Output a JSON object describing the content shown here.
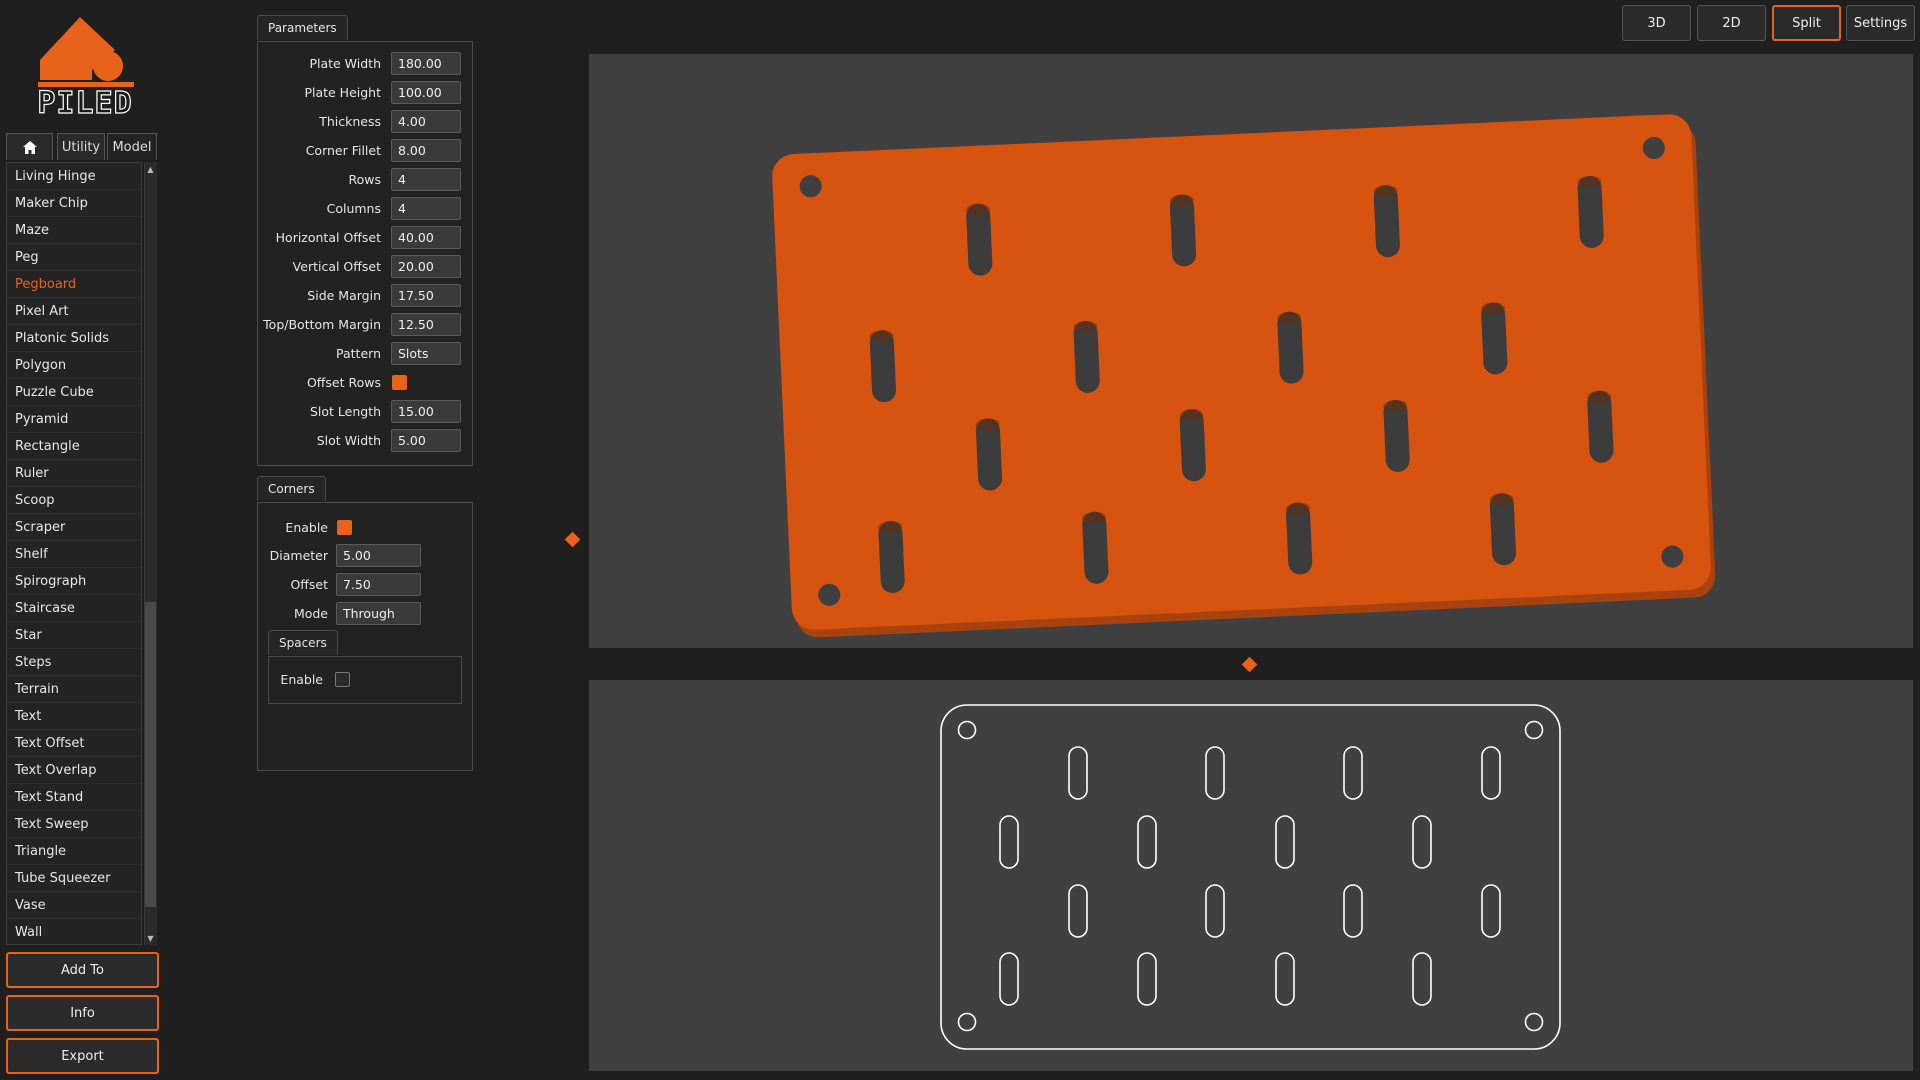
{
  "app": {
    "logo_text": "PILED",
    "accent_color": "#e8621a"
  },
  "sidebar": {
    "tabs": [
      {
        "icon": "home-icon",
        "label": ""
      },
      {
        "label": "Utility"
      },
      {
        "label": "Model"
      }
    ],
    "items": [
      "Living Hinge",
      "Maker Chip",
      "Maze",
      "Peg",
      "Pegboard",
      "Pixel Art",
      "Platonic Solids",
      "Polygon",
      "Puzzle Cube",
      "Pyramid",
      "Rectangle",
      "Ruler",
      "Scoop",
      "Scraper",
      "Shelf",
      "Spirograph",
      "Staircase",
      "Star",
      "Steps",
      "Terrain",
      "Text",
      "Text Offset",
      "Text Overlap",
      "Text Stand",
      "Text Sweep",
      "Triangle",
      "Tube Squeezer",
      "Vase",
      "Wall"
    ],
    "selected": "Pegboard",
    "buttons": {
      "add_to": "Add To",
      "info": "Info",
      "export": "Export"
    }
  },
  "parameters": {
    "title": "Parameters",
    "fields": [
      {
        "label": "Plate Width",
        "value": "180.00"
      },
      {
        "label": "Plate Height",
        "value": "100.00"
      },
      {
        "label": "Thickness",
        "value": "4.00"
      },
      {
        "label": "Corner Fillet",
        "value": "8.00"
      },
      {
        "label": "Rows",
        "value": "4"
      },
      {
        "label": "Columns",
        "value": "4"
      },
      {
        "label": "Horizontal Offset",
        "value": "40.00"
      },
      {
        "label": "Vertical Offset",
        "value": "20.00"
      },
      {
        "label": "Side Margin",
        "value": "17.50"
      },
      {
        "label": "Top/Bottom Margin",
        "value": "12.50"
      },
      {
        "label": "Pattern",
        "value": "Slots"
      },
      {
        "label": "Offset Rows",
        "checked": true
      },
      {
        "label": "Slot Length",
        "value": "15.00"
      },
      {
        "label": "Slot Width",
        "value": "5.00"
      }
    ]
  },
  "corners": {
    "title": "Corners",
    "enable_label": "Enable",
    "enable_checked": true,
    "diameter_label": "Diameter",
    "diameter_value": "5.00",
    "offset_label": "Offset",
    "offset_value": "7.50",
    "mode_label": "Mode",
    "mode_value": "Through",
    "spacers": {
      "title": "Spacers",
      "enable_label": "Enable",
      "enable_checked": false
    }
  },
  "view_modes": {
    "buttons": [
      "3D",
      "2D",
      "Split",
      "Settings"
    ],
    "active": "Split"
  }
}
